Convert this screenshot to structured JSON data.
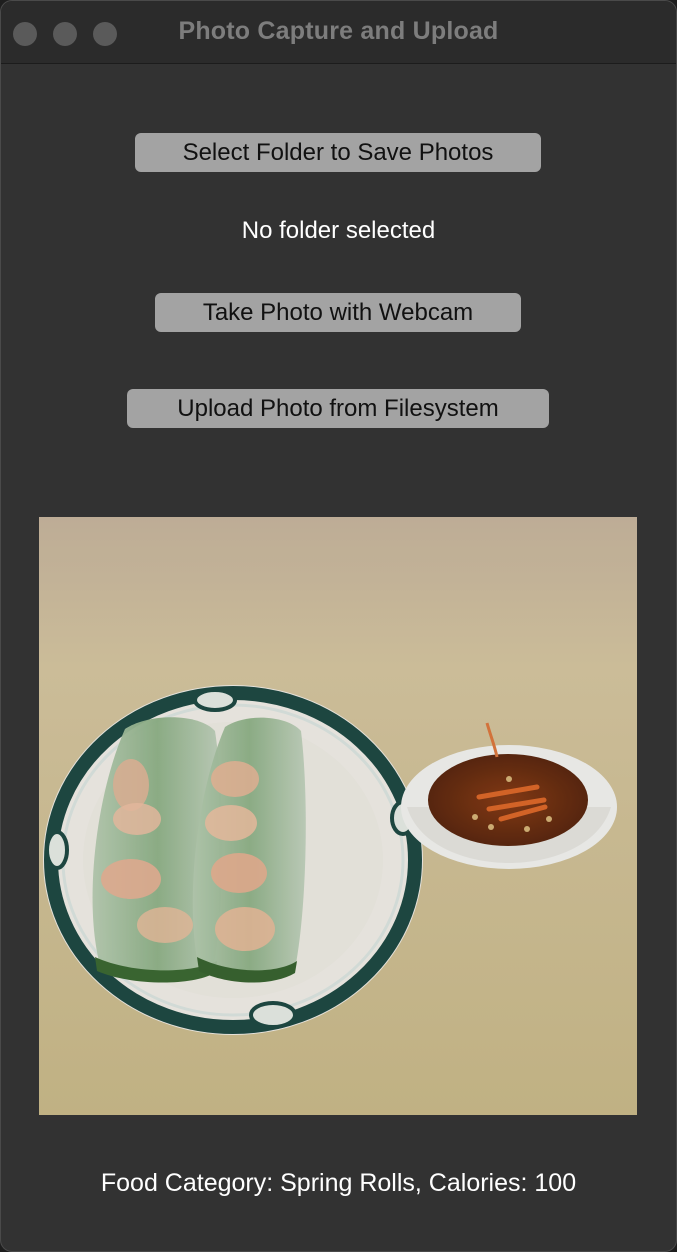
{
  "window": {
    "title": "Photo Capture and Upload"
  },
  "buttons": {
    "select_folder": "Select Folder to Save Photos",
    "take_photo": "Take Photo with Webcam",
    "upload_photo": "Upload Photo from Filesystem"
  },
  "folder_status": "No folder selected",
  "photo": {
    "subject": "spring-rolls-with-dipping-sauce"
  },
  "result_text": "Food Category: Spring Rolls, Calories: 100",
  "colors": {
    "window_bg": "#323232",
    "button_bg": "#a3a3a3",
    "text": "#ffffff"
  }
}
